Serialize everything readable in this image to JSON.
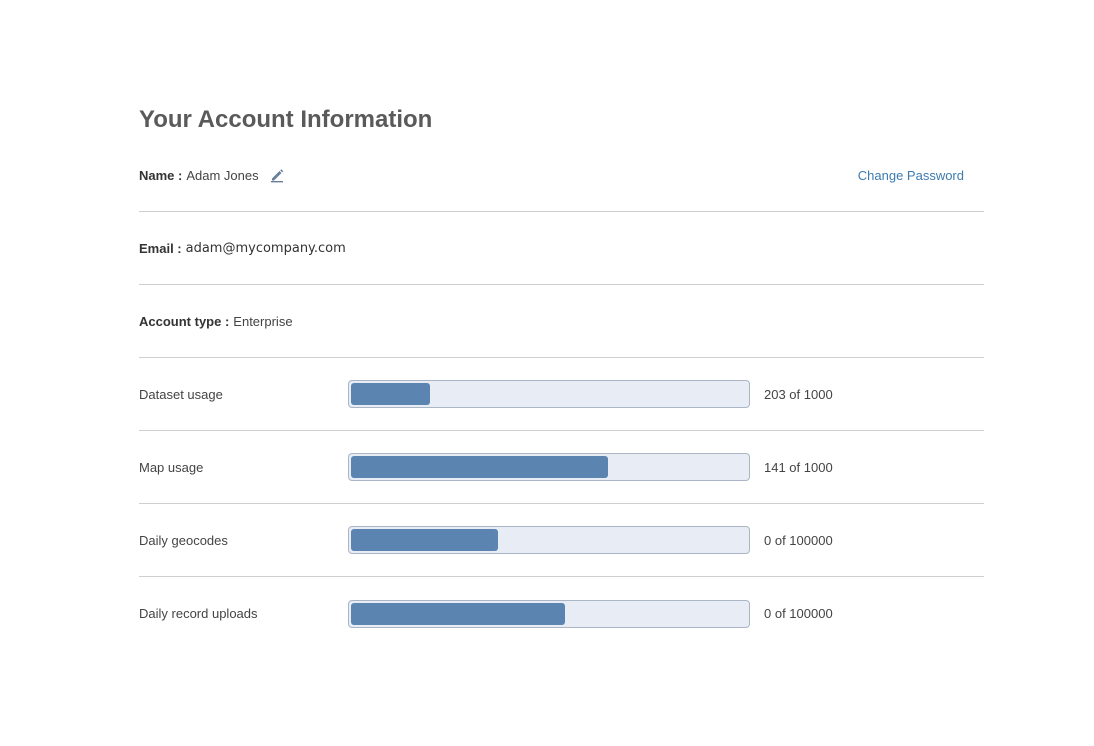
{
  "page": {
    "title": "Your Account Information"
  },
  "account": {
    "name_label": "Name :",
    "name_value": "Adam Jones",
    "change_password": "Change Password",
    "email_label": "Email :",
    "email_value": "adam@mycompany.com",
    "account_type_label": "Account type :",
    "account_type_value": "Enterprise"
  },
  "usage": [
    {
      "label": "Dataset usage",
      "count": "203 of 1000",
      "fill_fraction": 0.2
    },
    {
      "label": "Map usage",
      "count": "141 of 1000",
      "fill_fraction": 0.65
    },
    {
      "label": "Daily geocodes",
      "count": "0 of 100000",
      "fill_fraction": 0.37
    },
    {
      "label": "Daily record uploads",
      "count": "0 of 100000",
      "fill_fraction": 0.54
    }
  ],
  "colors": {
    "accent_link": "#3d7bb0",
    "bar_fill": "#5b84b1",
    "bar_track": "#e8edf5"
  },
  "icons": {
    "edit": "pencil-icon"
  }
}
